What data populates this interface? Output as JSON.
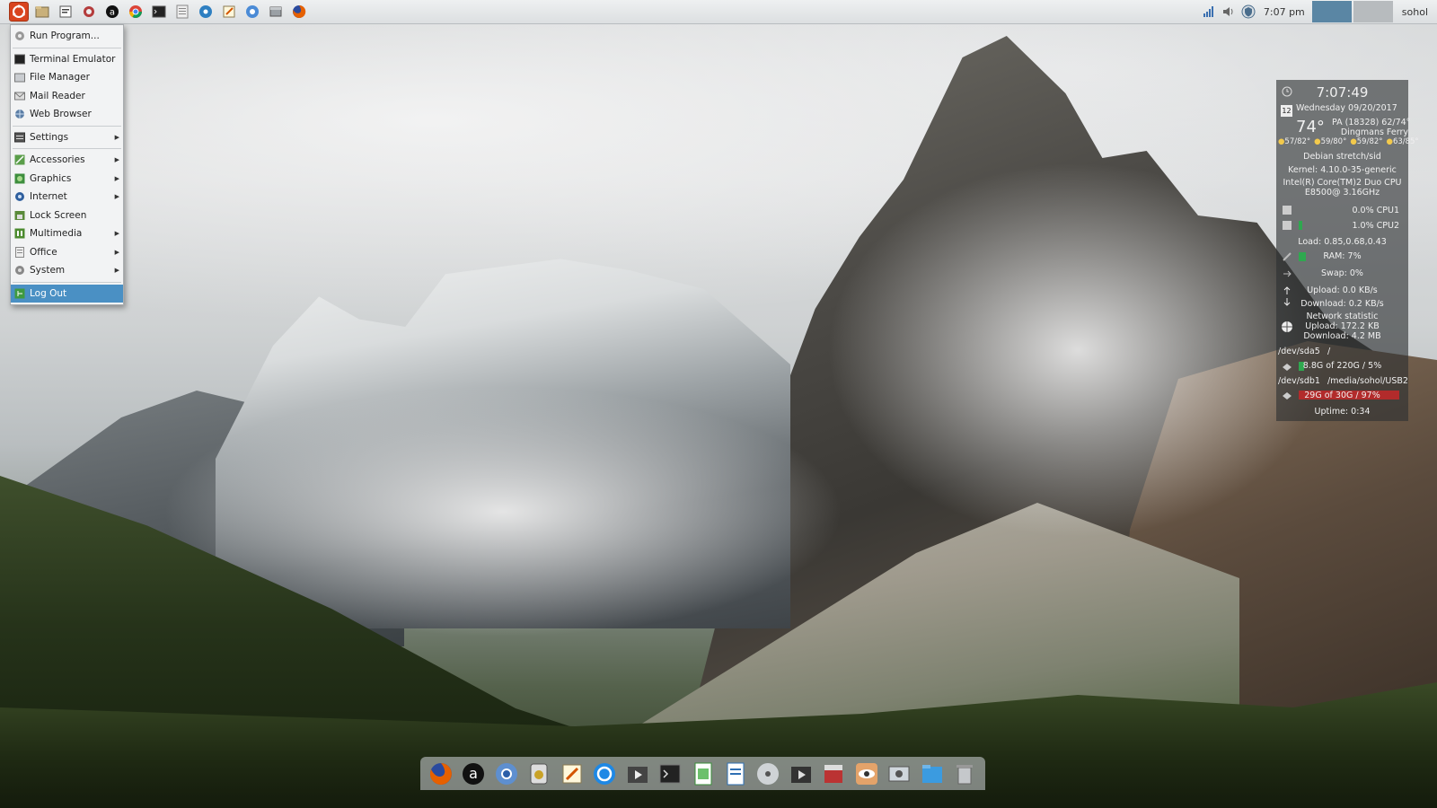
{
  "top_panel": {
    "launcher_icons": [
      "app-menu-icon",
      "file-manager-icon",
      "text-editor-icon",
      "network-icon",
      "amazon-icon",
      "chrome-icon",
      "terminal-icon",
      "document-icon",
      "media-icon",
      "notes-icon",
      "chromium-icon",
      "files-icon",
      "firefox-icon"
    ],
    "tray": {
      "clock": "7:07 pm",
      "user": "sohol",
      "icons": [
        "signal-icon",
        "volume-icon",
        "shield-icon"
      ]
    }
  },
  "app_menu": {
    "items": [
      {
        "label": "Run Program...",
        "icon": "run-icon",
        "submenu": false
      },
      {
        "sep": true
      },
      {
        "label": "Terminal Emulator",
        "icon": "terminal-icon",
        "submenu": false
      },
      {
        "label": "File Manager",
        "icon": "file-manager-icon",
        "submenu": false
      },
      {
        "label": "Mail Reader",
        "icon": "mail-icon",
        "submenu": false
      },
      {
        "label": "Web Browser",
        "icon": "globe-icon",
        "submenu": false
      },
      {
        "sep": true
      },
      {
        "label": "Settings",
        "icon": "settings-icon",
        "submenu": true
      },
      {
        "sep": true
      },
      {
        "label": "Accessories",
        "icon": "accessories-icon",
        "submenu": true
      },
      {
        "label": "Graphics",
        "icon": "graphics-icon",
        "submenu": true
      },
      {
        "label": "Internet",
        "icon": "internet-icon",
        "submenu": true
      },
      {
        "label": "Lock Screen",
        "icon": "lock-icon",
        "submenu": false
      },
      {
        "label": "Multimedia",
        "icon": "multimedia-icon",
        "submenu": true
      },
      {
        "label": "Office",
        "icon": "office-icon",
        "submenu": true
      },
      {
        "label": "System",
        "icon": "system-icon",
        "submenu": true
      },
      {
        "sep": true
      },
      {
        "label": "Log Out",
        "icon": "logout-icon",
        "submenu": false,
        "highlighted": true
      }
    ]
  },
  "conky": {
    "time": "7:07:49",
    "date": "Wednesday 09/20/2017",
    "calendar_day": "12",
    "temperature": "74°",
    "location_line1": "PA (18328) 62/74°",
    "location_line2": "Dingmans Ferry",
    "forecast": [
      "57/82°",
      "59/80°",
      "59/82°",
      "63/85°"
    ],
    "os": "Debian stretch/sid",
    "kernel": "Kernel: 4.10.0-35-generic",
    "cpu_model_line1": "Intel(R) Core(TM)2 Duo CPU",
    "cpu_model_line2": "E8500@ 3.16GHz",
    "cpu1": "0.0% CPU1",
    "cpu2": "1.0% CPU2",
    "load": "Load: 0.85,0.68,0.43",
    "ram": "RAM: 7%",
    "swap": "Swap: 0%",
    "upload": "Upload: 0.0 KB/s",
    "download": "Download: 0.2 KB/s",
    "net_title": "Network statistic",
    "net_upload": "Upload: 172.2 KB",
    "net_download": "Download: 4.2 MB",
    "disk1_dev": "/dev/sda5",
    "disk1_mount": "/",
    "disk1_usage": "8.8G of 220G / 5%",
    "disk2_dev": "/dev/sdb1",
    "disk2_mount": "/media/sohol/USB20",
    "disk2_usage": "29G of 30G / 97%",
    "uptime": "Uptime: 0:34",
    "levels": {
      "cpu1": 0.0,
      "cpu2": 0.01,
      "ram": 0.07,
      "swap": 0.0,
      "disk1": 0.05,
      "disk2": 0.97
    },
    "colors": {
      "bar": "#2fa84f",
      "alert": "#b22b2b"
    }
  },
  "dock": {
    "items": [
      "firefox-icon",
      "amazon-icon",
      "chromium-icon",
      "media-player-icon",
      "text-editor-icon",
      "sync-icon",
      "video-icon",
      "terminal-icon",
      "spreadsheet-icon",
      "document-icon",
      "disc-icon",
      "movie-icon",
      "package-icon",
      "eye-icon",
      "screenshot-icon",
      "folder-icon",
      "trash-icon"
    ]
  }
}
